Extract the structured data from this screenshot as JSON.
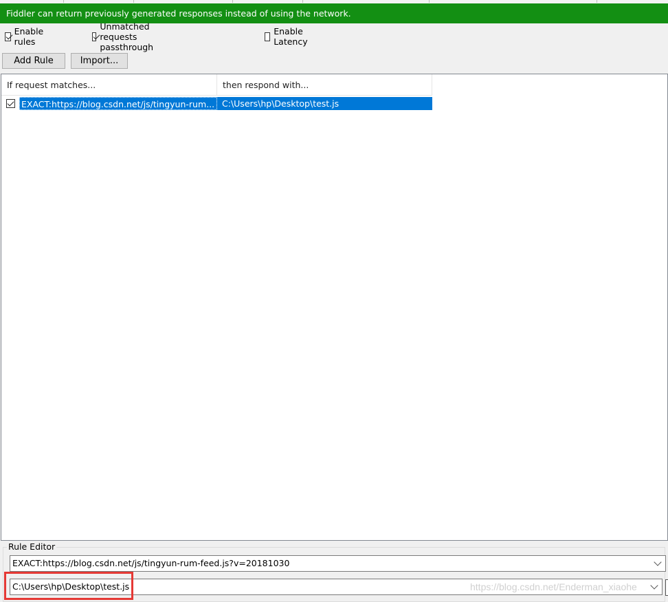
{
  "banner": {
    "text": "Fiddler can return previously generated responses instead of using the network.",
    "color": "#138f13"
  },
  "options": {
    "enable_rules": {
      "label": "Enable rules",
      "checked": true
    },
    "unmatched_passthrough": {
      "label": "Unmatched requests passthrough",
      "checked": true
    },
    "enable_latency": {
      "label": "Enable Latency",
      "checked": false
    }
  },
  "toolbar": {
    "add_rule_label": "Add Rule",
    "import_label": "Import..."
  },
  "rules_table": {
    "columns": [
      "If request matches...",
      "then respond with..."
    ],
    "rows": [
      {
        "checked": true,
        "match": "EXACT:https://blog.csdn.net/js/tingyun-rum...",
        "respond": "C:\\Users\\hp\\Desktop\\test.js",
        "selected": true
      }
    ],
    "selection_color": "#0078d7"
  },
  "rule_editor": {
    "title": "Rule Editor",
    "match_value": "EXACT:https://blog.csdn.net/js/tingyun-rum-feed.js?v=20181030",
    "respond_value": "C:\\Users\\hp\\Desktop\\test.js",
    "highlight_color": "#e53935"
  },
  "watermark": "https://blog.csdn.net/Enderman_xiaohe"
}
